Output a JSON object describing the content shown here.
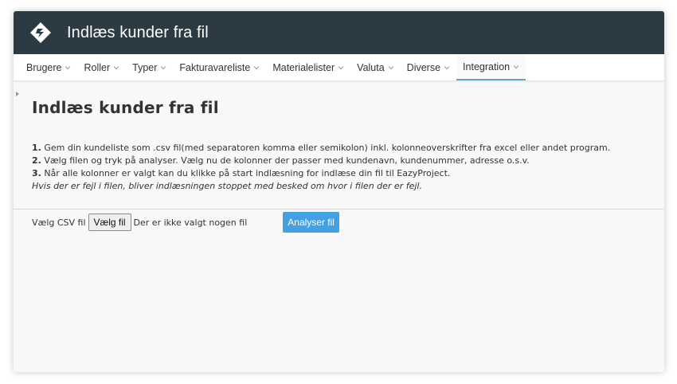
{
  "header": {
    "title": "Indlæs kunder fra fil",
    "logo_icon": "eazyproject-logo-icon"
  },
  "nav": {
    "items": [
      {
        "label": "Brugere"
      },
      {
        "label": "Roller"
      },
      {
        "label": "Typer"
      },
      {
        "label": "Fakturavareliste"
      },
      {
        "label": "Materialelister"
      },
      {
        "label": "Valuta"
      },
      {
        "label": "Diverse"
      },
      {
        "label": "Integration",
        "active": true
      }
    ]
  },
  "page": {
    "title": "Indlæs kunder fra fil",
    "steps": [
      {
        "num": "1.",
        "text": " Gem din kundeliste som .csv fil(med separatoren komma eller semikolon) inkl. kolonneoverskrifter fra excel eller andet program."
      },
      {
        "num": "2.",
        "text": " Vælg filen og tryk på analyser. Vælg nu de kolonner der passer med kundenavn, kundenummer, adresse o.s.v."
      },
      {
        "num": "3.",
        "text": " Når alle kolonner er valgt kan du klikke på start indlæsning for indlæse din fil til EazyProject."
      }
    ],
    "note": "Hvis der er fejl i filen, bliver indlæsningen stoppet med besked om hvor i filen der er fejl.",
    "file_label": "Vælg CSV fil",
    "file_button": "Vælg fil",
    "file_status": "Der er ikke valgt nogen fil",
    "analyse_button": "Analyser fil"
  },
  "colors": {
    "titlebar": "#2c3a43",
    "accent": "#42a0e3",
    "active_underline": "#5fa8c4"
  }
}
